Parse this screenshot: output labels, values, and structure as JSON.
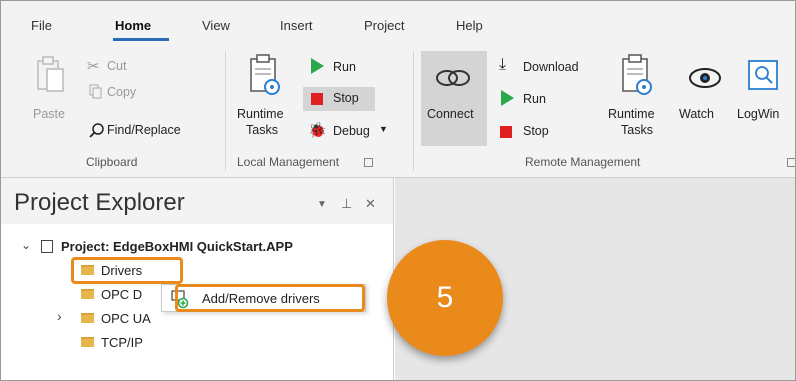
{
  "menu": {
    "tabs": [
      "File",
      "Home",
      "View",
      "Insert",
      "Project",
      "Help"
    ],
    "active": "Home"
  },
  "ribbon": {
    "clipboard": {
      "label": "Clipboard",
      "paste": "Paste",
      "cut": "Cut",
      "copy": "Copy",
      "find_replace": "Find/Replace"
    },
    "local": {
      "label": "Local Management",
      "runtime_tasks_line1": "Runtime",
      "runtime_tasks_line2": "Tasks",
      "run": "Run",
      "stop": "Stop",
      "debug": "Debug"
    },
    "remote": {
      "label": "Remote Management",
      "connect": "Connect",
      "download": "Download",
      "run": "Run",
      "stop": "Stop",
      "runtime_tasks_line1": "Runtime",
      "runtime_tasks_line2": "Tasks",
      "watch": "Watch",
      "logwin": "LogWin"
    }
  },
  "explorer": {
    "title": "Project Explorer",
    "project": "Project: EdgeBoxHMI QuickStart.APP",
    "items": [
      "Drivers",
      "OPC D",
      "OPC UA",
      "TCP/IP"
    ]
  },
  "context_menu": {
    "item": "Add/Remove drivers"
  },
  "callout": {
    "step": "5"
  },
  "colors": {
    "accent": "#e98a1a",
    "tab_underline": "#2b6cb8",
    "run_green": "#2aa84a",
    "stop_red": "#e02020",
    "folder": "#e6b84b"
  }
}
